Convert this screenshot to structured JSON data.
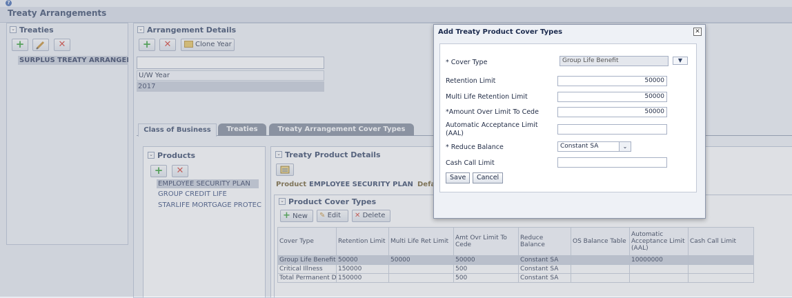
{
  "page": {
    "title": "Treaty Arrangements"
  },
  "treaties": {
    "title": "Treaties",
    "items": [
      "SURPLUS TREATY ARRANGEME"
    ]
  },
  "arrangement": {
    "title": "Arrangement Details",
    "clone_label": "Clone Year",
    "uw_year_label": "U/W Year",
    "uw_year_value": "2017"
  },
  "tabs": [
    {
      "label": "Class of Business"
    },
    {
      "label": "Treaties"
    },
    {
      "label": "Treaty Arrangement Cover Types"
    }
  ],
  "products": {
    "title": "Products",
    "items": [
      "EMPLOYEE SECURITY PLAN",
      "GROUP CREDIT LIFE",
      "STARLIFE MORTGAGE PROTECT"
    ]
  },
  "details": {
    "title": "Treaty Product Details",
    "product_label": "Product",
    "product_value": "EMPLOYEE SECURITY PLAN",
    "default_label_fragment": "Defa"
  },
  "cover_types": {
    "title": "Product Cover Types",
    "new_label": "New",
    "edit_label": "Edit",
    "delete_label": "Delete",
    "headers": [
      "Cover Type",
      "Retention Limit",
      "Multi Life Ret Limit",
      "Amt Ovr Limit To Cede",
      "Reduce Balance",
      "OS Balance Table",
      "Automatic Acceptance Limit (AAL)",
      "Cash Call Limit"
    ],
    "rows": [
      [
        "Group Life Benefit",
        "50000",
        "50000",
        "50000",
        "Constant SA",
        "",
        "10000000",
        ""
      ],
      [
        "Critical Illness",
        "150000",
        "",
        "500",
        "Constant SA",
        "",
        "",
        ""
      ],
      [
        "Total Permanent D",
        "150000",
        "",
        "500",
        "Constant SA",
        "",
        "",
        ""
      ]
    ]
  },
  "dialog": {
    "title": "Add Treaty Product Cover Types",
    "cover_type_label": "* Cover Type",
    "cover_type_value": "Group Life Benefit",
    "retention_label": "Retention Limit",
    "retention_value": "50000",
    "multi_life_label": "Multi Life Retention Limit",
    "multi_life_value": "50000",
    "amount_over_label": "*Amount Over Limit To Cede",
    "amount_over_value": "50000",
    "aal_label_line1": "Automatic Acceptance Limit",
    "aal_label_line2": "(AAL)",
    "aal_value": "",
    "reduce_label": "* Reduce Balance",
    "reduce_value": "Constant SA",
    "cash_call_label": "Cash Call Limit",
    "cash_call_value": "",
    "save_label": "Save",
    "cancel_label": "Cancel"
  },
  "icons": {
    "help": "help-icon",
    "add": "plus-icon",
    "edit": "pencil-icon",
    "delete": "x-icon",
    "clone": "folder-icon",
    "details": "form-icon",
    "close": "close-icon",
    "dropdown": "chevron-down-icon"
  },
  "colors": {
    "selection": "#c7ccd9",
    "tab_inactive": "#7e8898",
    "accent_green": "#2f9d2f",
    "accent_red": "#d4372a"
  }
}
